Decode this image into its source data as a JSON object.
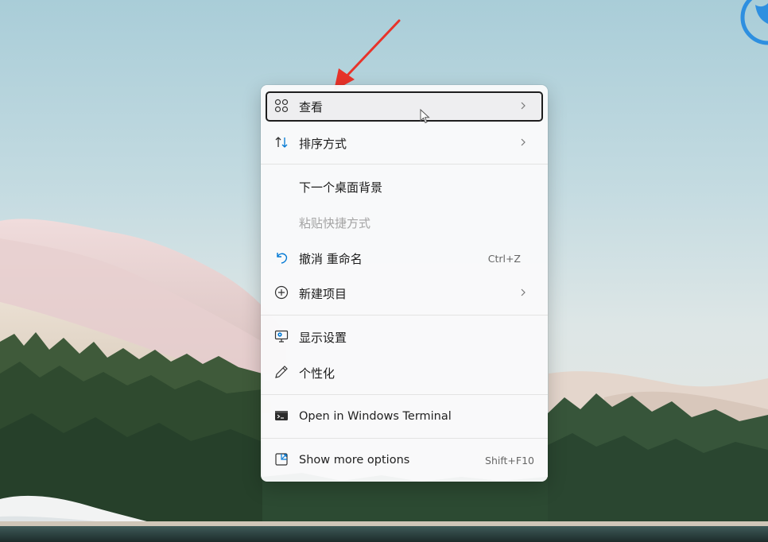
{
  "menu": {
    "items": [
      {
        "key": "view",
        "label": "查看",
        "icon": "grid-four-icon",
        "submenu": true,
        "highlighted": true
      },
      {
        "key": "sort",
        "label": "排序方式",
        "icon": "sort-arrows-icon",
        "submenu": true
      },
      {
        "key": "next_bg",
        "label": "下一个桌面背景"
      },
      {
        "key": "paste_shortcut",
        "label": "粘贴快捷方式",
        "disabled": true
      },
      {
        "key": "undo",
        "label": "撤消 重命名",
        "icon": "undo-icon",
        "shortcut": "Ctrl+Z"
      },
      {
        "key": "new",
        "label": "新建项目",
        "icon": "plus-circle-icon",
        "submenu": true
      },
      {
        "key": "display",
        "label": "显示设置",
        "icon": "monitor-settings-icon"
      },
      {
        "key": "personalize",
        "label": "个性化",
        "icon": "pen-icon"
      },
      {
        "key": "terminal",
        "label": "Open in Windows Terminal",
        "icon": "terminal-icon"
      },
      {
        "key": "more",
        "label": "Show more options",
        "icon": "expand-icon",
        "shortcut": "Shift+F10"
      }
    ]
  },
  "colors": {
    "accent": "#0078d4",
    "annotation_arrow": "#e8332a",
    "menu_background": "#fafafb",
    "highlight_border": "#1e1e1e"
  }
}
